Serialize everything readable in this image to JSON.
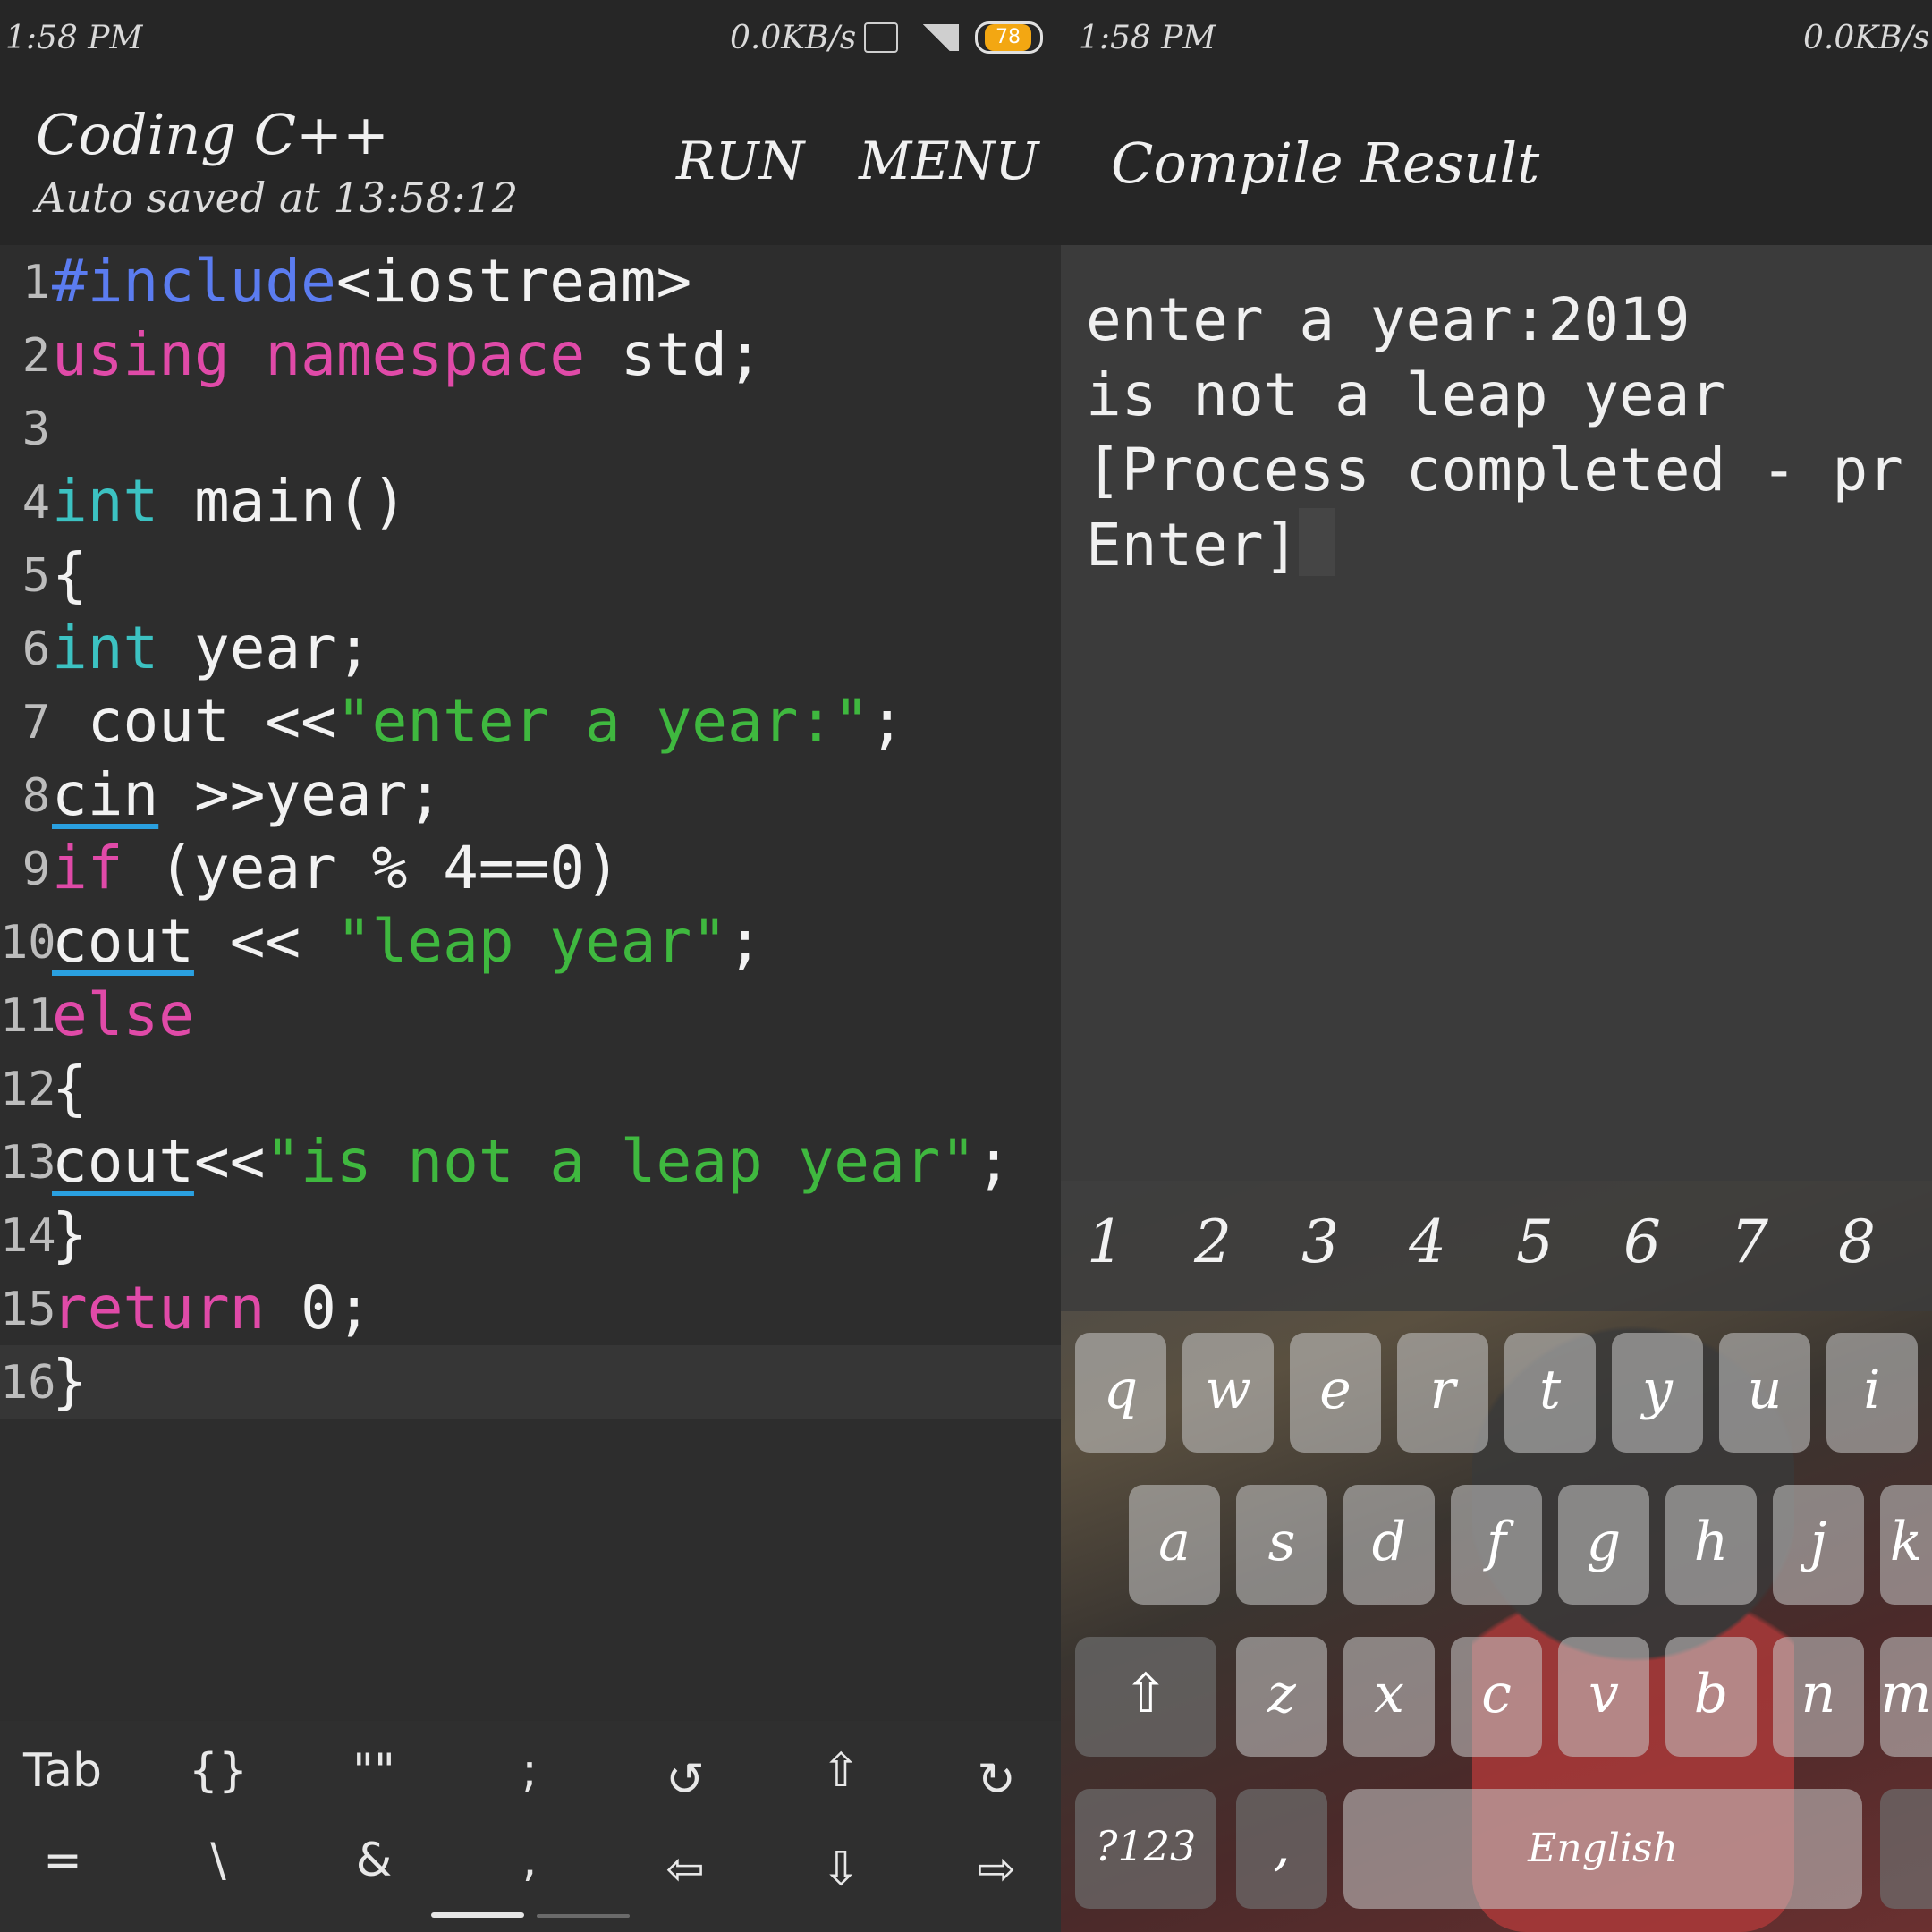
{
  "status": {
    "time": "1:58 PM",
    "net_speed": "0.0KB/s",
    "battery": "78",
    "net_speed_right": "0.0KB/s"
  },
  "editor_app": {
    "title": "Coding C++",
    "subtitle": "Auto saved at 13:58:12",
    "run_label": "RUN",
    "menu_label": "MENU"
  },
  "code_lines": [
    {
      "n": "1"
    },
    {
      "n": "2"
    },
    {
      "n": "3"
    },
    {
      "n": "4"
    },
    {
      "n": "5"
    },
    {
      "n": "6"
    },
    {
      "n": "7"
    },
    {
      "n": "8"
    },
    {
      "n": "9"
    },
    {
      "n": "10"
    },
    {
      "n": "11"
    },
    {
      "n": "12"
    },
    {
      "n": "13"
    },
    {
      "n": "14"
    },
    {
      "n": "15"
    },
    {
      "n": "16"
    }
  ],
  "code": {
    "l1_a": "#include",
    "l1_b": "<iostream>",
    "l2_a": "using",
    "l2_b": "namespace",
    "l2_c": " std;",
    "l4_a": "int",
    "l4_b": " main()",
    "l5": "{",
    "l6_a": "int",
    "l6_b": " year;",
    "l7_a": " cout <<",
    "l7_b": "\"enter a year:\"",
    "l7_c": ";",
    "l8_a": "cin",
    "l8_b": " >>year;",
    "l9_a": "if",
    "l9_b": " (year % 4==0)",
    "l10_a": "cout",
    "l10_b": " << ",
    "l10_c": "\"leap year\"",
    "l10_d": ";",
    "l11": "else",
    "l12": "{",
    "l13_a": "cout",
    "l13_b": "<<",
    "l13_c": "\"is not a leap year\"",
    "l13_d": ";",
    "l14": "}",
    "l15_a": "return",
    "l15_b": " 0;",
    "l16": "}"
  },
  "toolbar": {
    "row1": [
      "Tab",
      "{}",
      "\"\"",
      ";",
      "↺",
      "⇧",
      "↻"
    ],
    "row2": [
      "=",
      "\\",
      "&",
      ",",
      "⇦",
      "⇩",
      "⇨"
    ]
  },
  "result_app": {
    "title": "Compile Result",
    "output_lines": [
      "enter a year:2019",
      "is not a leap year",
      "[Process completed - pr",
      "Enter]"
    ]
  },
  "keyboard": {
    "numbers": [
      "1",
      "2",
      "3",
      "4",
      "5",
      "6",
      "7",
      "8"
    ],
    "row1": [
      "q",
      "w",
      "e",
      "r",
      "t",
      "y",
      "u",
      "i"
    ],
    "row2": [
      "a",
      "s",
      "d",
      "f",
      "g",
      "h",
      "j",
      "k"
    ],
    "row3": [
      "z",
      "x",
      "c",
      "v",
      "b",
      "n",
      "m"
    ],
    "symbols_label": "?123",
    "comma": ",",
    "space_label": "English",
    "shift_icon": "⇧"
  },
  "colors": {
    "include": "#5b7cf0",
    "keyword": "#e04aa8",
    "type": "#3cc2c2",
    "string": "#3fb83f",
    "underline": "#2aa0e0"
  }
}
